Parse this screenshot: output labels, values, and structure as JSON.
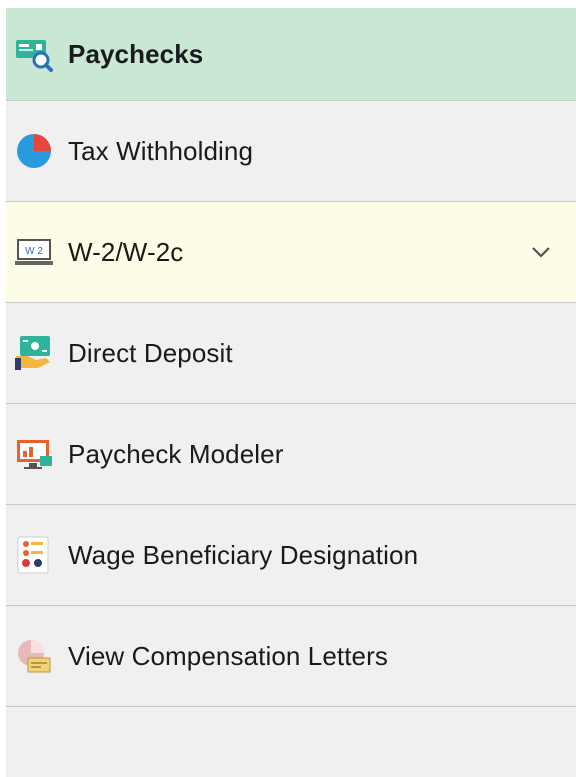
{
  "nav": {
    "items": [
      {
        "label": "Paychecks",
        "icon": "paycheck-search-icon",
        "state": "active"
      },
      {
        "label": "Tax Withholding",
        "icon": "pie-chart-icon"
      },
      {
        "label": "W-2/W-2c",
        "icon": "w2-form-icon",
        "state": "expanded"
      },
      {
        "label": "Direct Deposit",
        "icon": "direct-deposit-icon"
      },
      {
        "label": "Paycheck Modeler",
        "icon": "monitor-chart-icon"
      },
      {
        "label": "Wage Beneficiary Designation",
        "icon": "beneficiary-icon"
      },
      {
        "label": "View Compensation Letters",
        "icon": "compensation-letters-icon"
      }
    ],
    "w2_subitems_toggle": "chevron-down-icon"
  },
  "colors": {
    "active_bg": "#c8e8d4",
    "expanded_bg": "#fdfce6",
    "item_bg": "#f0f0f0",
    "divider": "#c8c8c8"
  }
}
